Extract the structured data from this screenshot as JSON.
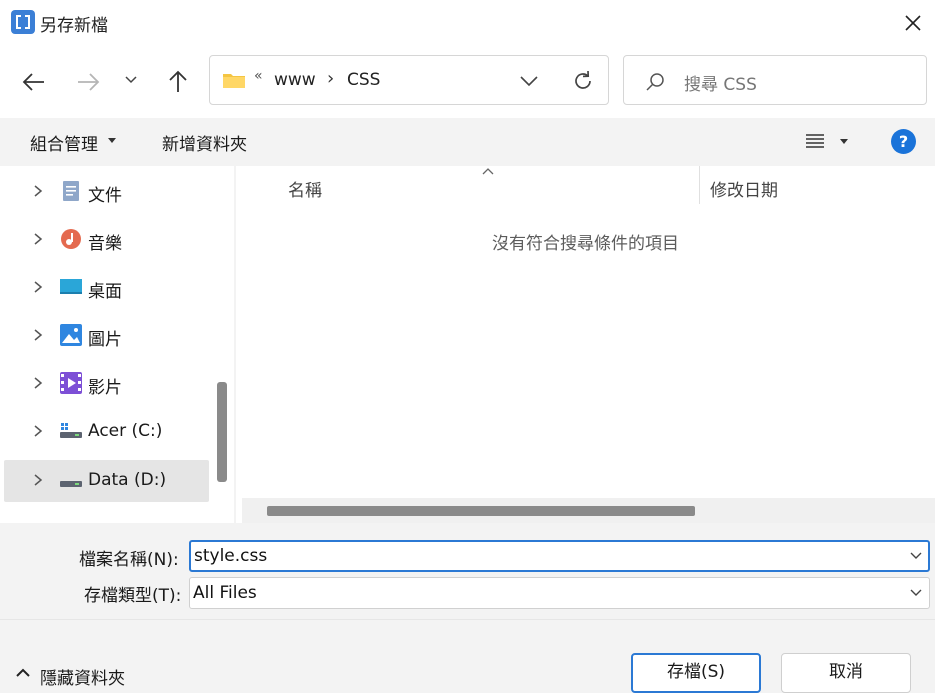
{
  "window": {
    "title": "另存新檔",
    "app_icon": "brackets-app-icon",
    "close_icon": "close-icon"
  },
  "nav": {
    "back_icon": "back-arrow-icon",
    "forward_icon": "forward-arrow-icon",
    "recent_icon": "chevron-down-icon",
    "up_icon": "up-arrow-icon",
    "address": {
      "overflow": "«",
      "crumbs": [
        "www",
        "CSS"
      ],
      "separator": "›"
    },
    "refresh_icon": "refresh-icon",
    "search": {
      "placeholder": "搜尋 CSS"
    }
  },
  "toolbar": {
    "organize": "組合管理",
    "new_folder": "新增資料夾",
    "view_icon": "view-list-icon",
    "help": "?"
  },
  "sidebar": {
    "items": [
      {
        "label": "文件",
        "icon": "documents-icon"
      },
      {
        "label": "音樂",
        "icon": "music-icon"
      },
      {
        "label": "桌面",
        "icon": "desktop-icon"
      },
      {
        "label": "圖片",
        "icon": "pictures-icon"
      },
      {
        "label": "影片",
        "icon": "videos-icon"
      },
      {
        "label": "Acer (C:)",
        "icon": "system-drive-icon"
      },
      {
        "label": "Data (D:)",
        "icon": "drive-icon",
        "selected": true
      }
    ]
  },
  "filelist": {
    "columns": {
      "name": "名稱",
      "date": "修改日期"
    },
    "empty_message": "沒有符合搜尋條件的項目"
  },
  "form": {
    "filename_label": "檔案名稱(N):",
    "filename_value": "style.css",
    "filetype_label": "存檔類型(T):",
    "filetype_value": "All Files"
  },
  "footer": {
    "hide_folders": "隱藏資料夾",
    "save": "存檔(S)",
    "cancel": "取消"
  },
  "colors": {
    "accent": "#2b79d4",
    "help": "#1a73d9",
    "selected_bg": "#e5e5e5"
  }
}
